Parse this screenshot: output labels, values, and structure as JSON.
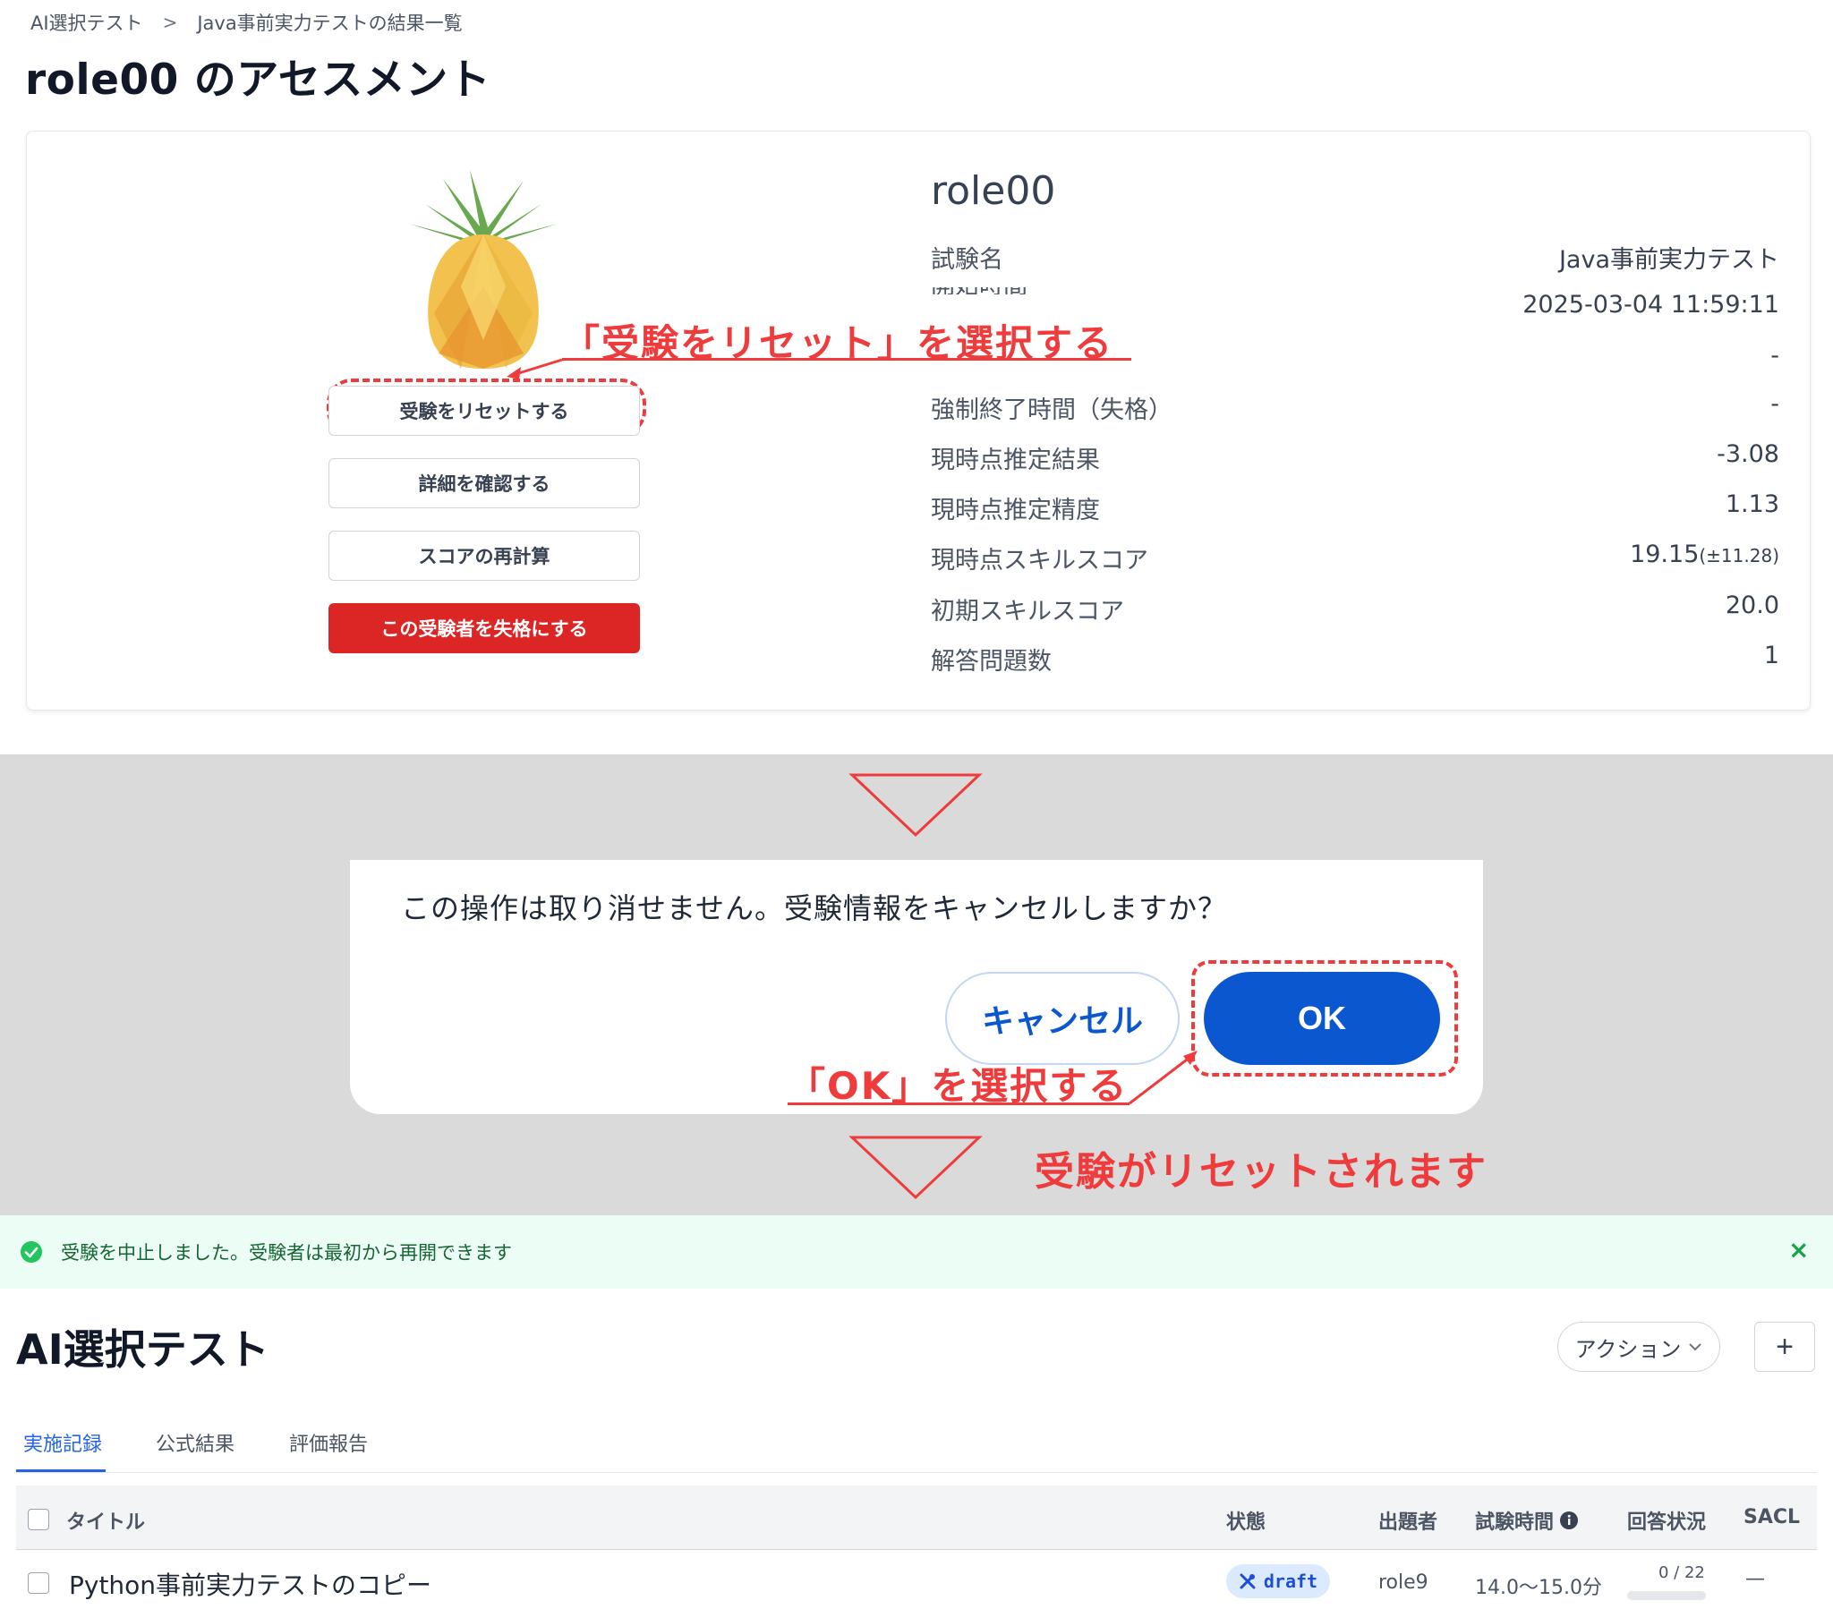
{
  "breadcrumb": {
    "items": [
      "AI選択テスト",
      "Java事前実力テストの結果一覧"
    ],
    "separator": ">"
  },
  "page": {
    "title": "role00 のアセスメント"
  },
  "profile": {
    "name": "role00",
    "fields": [
      {
        "label": "試験名",
        "value": "Java事前実力テスト"
      },
      {
        "label": "開始時間",
        "value": "2025-03-04 11:59:11"
      },
      {
        "label": "",
        "value": "-"
      },
      {
        "label": "強制終了時間（失格）",
        "value": "-"
      },
      {
        "label": "現時点推定結果",
        "value": "-3.08"
      },
      {
        "label": "現時点推定精度",
        "value": "1.13"
      },
      {
        "label": "現時点スキルスコア",
        "value": "19.15",
        "sub": "(±11.28)"
      },
      {
        "label": "初期スキルスコア",
        "value": "20.0"
      },
      {
        "label": "解答問題数",
        "value": "1"
      }
    ]
  },
  "actions": {
    "reset": "受験をリセットする",
    "detail": "詳細を確認する",
    "recalc": "スコアの再計算",
    "disqualify": "この受験者を失格にする"
  },
  "annotations": {
    "step1": "「受験をリセット」を選択する",
    "step2": "「OK」を選択する",
    "step3": "受験がリセットされます"
  },
  "dialog": {
    "message": "この操作は取り消せません。受験情報をキャンセルしますか？",
    "cancel": "キャンセル",
    "ok": "OK"
  },
  "alert": {
    "message": "受験を中止しました。受験者は最初から再開できます",
    "close": "×"
  },
  "list": {
    "title": "AI選択テスト",
    "action_label": "アクション",
    "plus": "+",
    "tabs": [
      "実施記録",
      "公式結果",
      "評価報告"
    ],
    "columns": [
      "タイトル",
      "状態",
      "出題者",
      "試験時間",
      "回答状況",
      "SACL"
    ],
    "rows": [
      {
        "title": "Python事前実力テストのコピー",
        "status": "draft",
        "author": "role9",
        "duration": "14.0〜15.0分",
        "progress_text": "0 / 22",
        "progress": 0,
        "sacl": "—"
      }
    ]
  },
  "colors": {
    "annotation": "#ef3b3b",
    "primary": "#0b57d0",
    "danger": "#dc2626",
    "success_bg": "#ecfdf5",
    "tab_active": "#2563eb"
  }
}
